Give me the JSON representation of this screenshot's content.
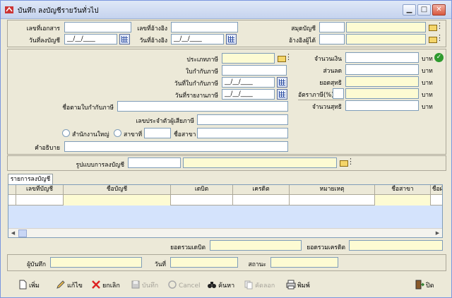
{
  "window": {
    "title": "บันทึก ลงบัญชีรายวันทั่วไป"
  },
  "header": {
    "doc_no_label": "เลขที่เอกสาร",
    "post_date_label": "วันที่ลงบัญชี",
    "post_date_value": "__/__/____",
    "ref_no_label": "เลขที่อ้างอิง",
    "ref_date_label": "วันที่อ้างอิง",
    "ref_date_value": "__/__/____",
    "book_label": "สมุดบัญชี",
    "ref_to_label": "อ้างอิงผู้ได้"
  },
  "tax": {
    "tax_type_label": "ประเภทภาษี",
    "tax_invoice_label": "ใบกำกับภาษี",
    "tax_invoice_date_label": "วันที่ใบกำกับภาษี",
    "tax_invoice_date_value": "__/__/____",
    "tax_report_date_label": "วันที่รายงานภาษี",
    "tax_report_date_value": "__/__/____",
    "name_on_invoice_label": "ชื่อตามใบกำกับภาษี",
    "taxpayer_id_label": "เลขประจำตัวผู้เสียภาษี",
    "head_office_label": "สำนักงานใหญ่",
    "branch_label": "สาขาที่",
    "branch_name_label": "ชื่อสาขา",
    "description_label": "คำอธิบาย"
  },
  "amounts": {
    "amount_label": "จำนวนเงิน",
    "discount_label": "ส่วนลด",
    "net_label": "ยอดสุทธิ",
    "tax_rate_label": "อัตราภาษี(%)",
    "net_total_label": "จำนวนสุทธิ",
    "unit": "บาท"
  },
  "posting_format_label": "รูปแบบการลงบัญชี",
  "grid": {
    "tab_label": "รายการลงบัญชี",
    "columns": [
      "เลขที่บัญชี",
      "ชื่อบัญชี",
      "เดบิต",
      "เครดิต",
      "หมายเหตุ",
      "ชื่อสาขา",
      "ชื่อฝ่าย"
    ]
  },
  "totals": {
    "debit_label": "ยอดรวมเดบิต",
    "credit_label": "ยอดรวมเครดิต"
  },
  "footer": {
    "recorder_label": "ผู้บันทึก",
    "date_label": "วันที่",
    "status_label": "สถานะ"
  },
  "toolbar": {
    "new": "เพิ่ม",
    "edit": "แก้ไข",
    "cancel_doc": "ยกเลิก",
    "save": "บันทึก",
    "cancel": "Cancel",
    "search": "ค้นหา",
    "copy": "คัดลอก",
    "print": "พิมพ์",
    "close": "ปิด"
  }
}
